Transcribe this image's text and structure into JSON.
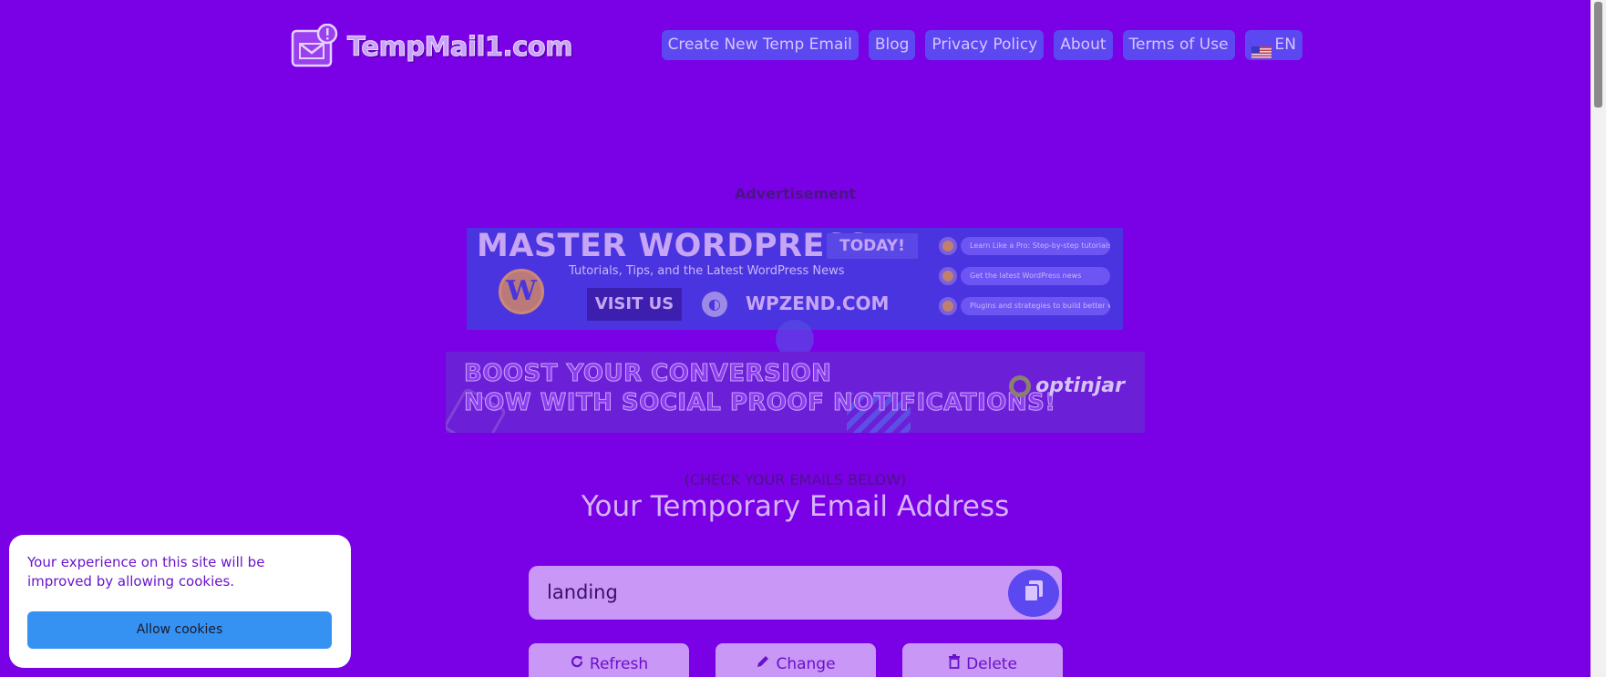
{
  "header": {
    "logo_text": "TempMail1.com",
    "nav": [
      {
        "label": "Create New Temp Email"
      },
      {
        "label": "Blog"
      },
      {
        "label": "Privacy Policy"
      },
      {
        "label": "About"
      },
      {
        "label": "Terms of Use"
      },
      {
        "label": "EN",
        "icon": "us-flag-icon"
      }
    ]
  },
  "ad": {
    "label": "Advertisement",
    "banner1": {
      "title": "MASTER WORDPRESS",
      "badge": "TODAY!",
      "subtitle": "Tutorials, Tips, and the Latest WordPress News",
      "cta": "VISIT US",
      "site": "WPZEND.COM",
      "features": [
        "Learn Like a Pro: Step-by-step tutorials",
        "Get the latest WordPress news",
        "Plugins and strategies to build better websites"
      ]
    },
    "banner2": {
      "line1": "BOOST YOUR CONVERSION",
      "line2": "NOW WITH SOCIAL PROOF NOTIFICATIONS!",
      "brand": "optinjar"
    }
  },
  "main": {
    "check_label": "(CHECK YOUR EMAILS BELOW)",
    "title": "Your Temporary Email Address",
    "email_value": "landing",
    "buttons": {
      "refresh": "Refresh",
      "change": "Change",
      "delete": "Delete"
    }
  },
  "cookie": {
    "text": "Your experience on this site will be improved by allowing cookies.",
    "button": "Allow cookies"
  },
  "colors": {
    "background": "#7a00e6",
    "nav_button": "#5b48f0",
    "accent_light": "#c997f5",
    "cookie_button": "#3592f3"
  }
}
